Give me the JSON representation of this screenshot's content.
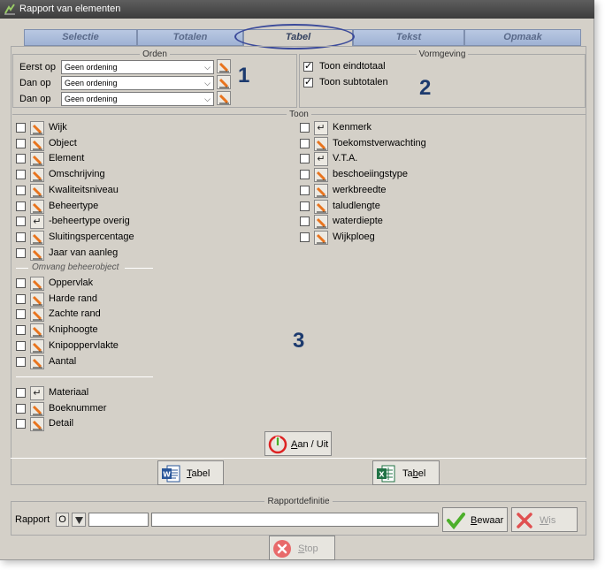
{
  "window": {
    "title": "Rapport van elementen"
  },
  "tabs": [
    {
      "label": "Selectie"
    },
    {
      "label": "Totalen"
    },
    {
      "label": "Tabel"
    },
    {
      "label": "Tekst"
    },
    {
      "label": "Opmaak"
    }
  ],
  "orden": {
    "legend": "Orden",
    "rows": [
      {
        "label": "Eerst op",
        "value": "Geen ordening"
      },
      {
        "label": "Dan op",
        "value": "Geen ordening"
      },
      {
        "label": "Dan op",
        "value": "Geen ordening"
      }
    ]
  },
  "vormgeving": {
    "legend": "Vormgeving",
    "items": [
      {
        "label": "Toon eindtotaal",
        "checked": true
      },
      {
        "label": "Toon subtotalen",
        "checked": true
      }
    ]
  },
  "callouts": [
    "1",
    "2",
    "3"
  ],
  "toon": {
    "legend": "Toon",
    "left_items": [
      {
        "label": "Wijk",
        "icon": "pencil"
      },
      {
        "label": "Object",
        "icon": "pencil"
      },
      {
        "label": "Element",
        "icon": "pencil"
      },
      {
        "label": "Omschrijving",
        "icon": "pencil"
      },
      {
        "label": "Kwaliteitsniveau",
        "icon": "pencil"
      },
      {
        "label": "Beheertype",
        "icon": "pencil"
      },
      {
        "label": "-beheertype overig",
        "icon": "return"
      },
      {
        "label": "Sluitingspercentage",
        "icon": "pencil"
      },
      {
        "label": "Jaar van aanleg",
        "icon": "pencil"
      }
    ],
    "omvang_label": "Omvang beheerobject",
    "omvang_items": [
      {
        "label": "Oppervlak",
        "icon": "pencil"
      },
      {
        "label": "Harde rand",
        "icon": "pencil"
      },
      {
        "label": "Zachte rand",
        "icon": "pencil"
      },
      {
        "label": "Kniphoogte",
        "icon": "pencil"
      },
      {
        "label": "Knipoppervlakte",
        "icon": "pencil"
      },
      {
        "label": "Aantal",
        "icon": "pencil"
      }
    ],
    "bottom_items": [
      {
        "label": "Materiaal",
        "icon": "return"
      },
      {
        "label": "Boeknummer",
        "icon": "pencil"
      },
      {
        "label": "Detail",
        "icon": "pencil"
      }
    ],
    "right_items": [
      {
        "label": "Kenmerk",
        "icon": "return"
      },
      {
        "label": "Toekomstverwachting",
        "icon": "pencil"
      },
      {
        "label": "V.T.A.",
        "icon": "return"
      },
      {
        "label": "beschoeiingstype",
        "icon": "pencil"
      },
      {
        "label": "werkbreedte",
        "icon": "pencil"
      },
      {
        "label": "taludlengte",
        "icon": "pencil"
      },
      {
        "label": "waterdiepte",
        "icon": "pencil"
      },
      {
        "label": "Wijkploeg",
        "icon": "pencil"
      }
    ],
    "toggle_button": {
      "label_u": "A",
      "label_rest": "an / Uit"
    }
  },
  "export": {
    "word": {
      "label_u": "T",
      "label_rest": "abel"
    },
    "excel": {
      "label_pre": "Ta",
      "label_u": "b",
      "label_rest": "el"
    }
  },
  "rapportdefinitie": {
    "legend": "Rapportdefinitie",
    "label": "Rapport",
    "code": "O",
    "save": {
      "label_u": "B",
      "label_rest": "ewaar"
    },
    "delete": {
      "label_u": "W",
      "label_rest": "is"
    }
  },
  "stop": {
    "label_u": "S",
    "label_rest": "top"
  },
  "colors": {
    "pencil_orange": "#e8741e",
    "check_green": "#4caf2a",
    "delete_red": "#e05050",
    "stop_red": "#e86a6a",
    "word_blue": "#2b579a",
    "excel_green": "#217346",
    "power_red": "#d22",
    "callout_blue": "#1c3a6e"
  }
}
